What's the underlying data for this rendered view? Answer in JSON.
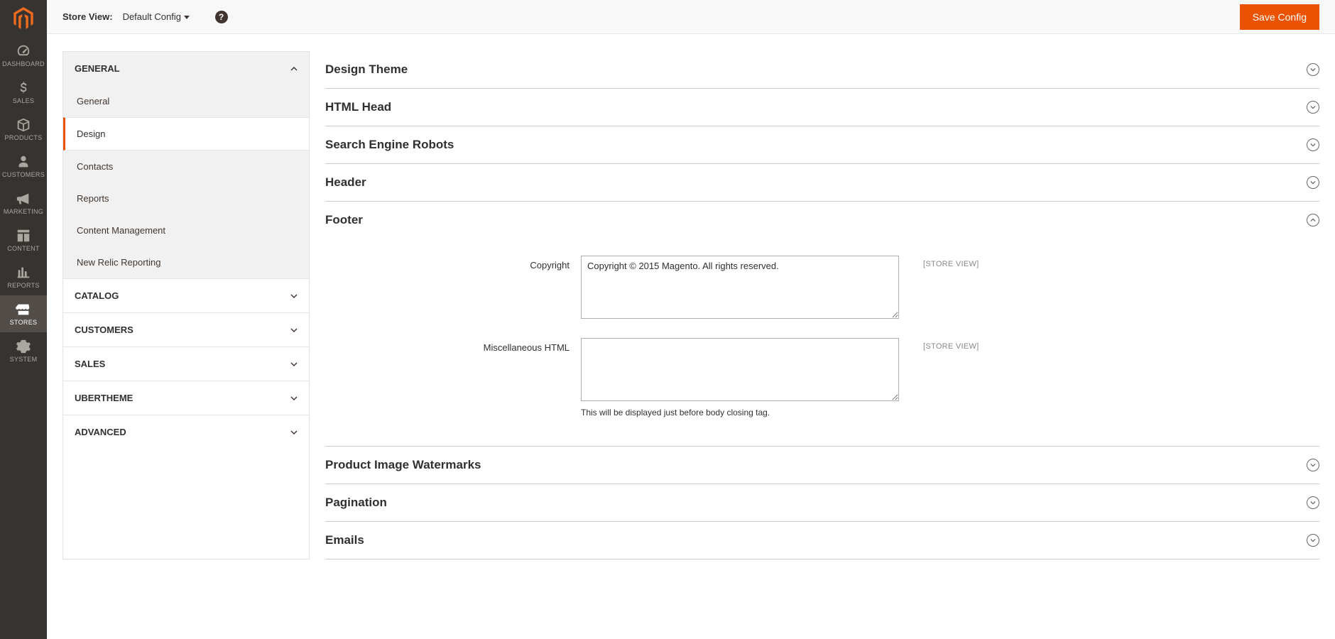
{
  "nav": {
    "items": [
      {
        "label": "DASHBOARD"
      },
      {
        "label": "SALES"
      },
      {
        "label": "PRODUCTS"
      },
      {
        "label": "CUSTOMERS"
      },
      {
        "label": "MARKETING"
      },
      {
        "label": "CONTENT"
      },
      {
        "label": "REPORTS"
      },
      {
        "label": "STORES"
      },
      {
        "label": "SYSTEM"
      }
    ]
  },
  "header": {
    "store_view_label": "Store View:",
    "store_view_value": "Default Config",
    "save_label": "Save Config"
  },
  "sidebar": {
    "groups": [
      {
        "label": "GENERAL",
        "expanded": true,
        "items": [
          {
            "label": "General"
          },
          {
            "label": "Design"
          },
          {
            "label": "Contacts"
          },
          {
            "label": "Reports"
          },
          {
            "label": "Content Management"
          },
          {
            "label": "New Relic Reporting"
          }
        ]
      },
      {
        "label": "CATALOG"
      },
      {
        "label": "CUSTOMERS"
      },
      {
        "label": "SALES"
      },
      {
        "label": "UBERTHEME"
      },
      {
        "label": "ADVANCED"
      }
    ]
  },
  "sections": {
    "design_theme": "Design Theme",
    "html_head": "HTML Head",
    "search_engine_robots": "Search Engine Robots",
    "header": "Header",
    "footer": "Footer",
    "product_image_watermarks": "Product Image Watermarks",
    "pagination": "Pagination",
    "emails": "Emails"
  },
  "footer_section": {
    "copyright_label": "Copyright",
    "copyright_value": "Copyright © 2015 Magento. All rights reserved.",
    "copyright_scope": "[STORE VIEW]",
    "misc_label": "Miscellaneous HTML",
    "misc_value": "",
    "misc_scope": "[STORE VIEW]",
    "misc_note": "This will be displayed just before body closing tag."
  }
}
